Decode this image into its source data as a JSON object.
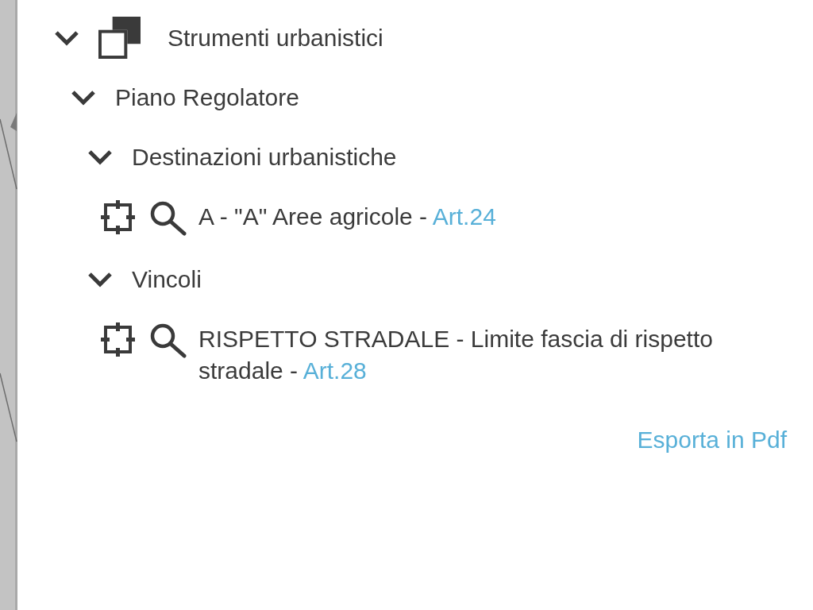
{
  "tree": [
    {
      "kind": "category",
      "label": "Strumenti urbanistici",
      "expanded": true,
      "children": [
        {
          "kind": "group",
          "label": "Piano Regolatore",
          "expanded": true,
          "children": [
            {
              "kind": "group",
              "label": "Destinazioni urbanistiche",
              "expanded": true,
              "children": [
                {
                  "kind": "layer",
                  "label": "A - \"A\" Aree agricole -",
                  "link": "Art.24"
                }
              ]
            },
            {
              "kind": "group",
              "label": "Vincoli",
              "expanded": true,
              "children": [
                {
                  "kind": "layer",
                  "label": "RISPETTO STRADALE - Limite fascia di rispetto stradale -",
                  "link": "Art.28"
                }
              ]
            }
          ]
        }
      ]
    }
  ],
  "export_link": "Esporta in Pdf"
}
